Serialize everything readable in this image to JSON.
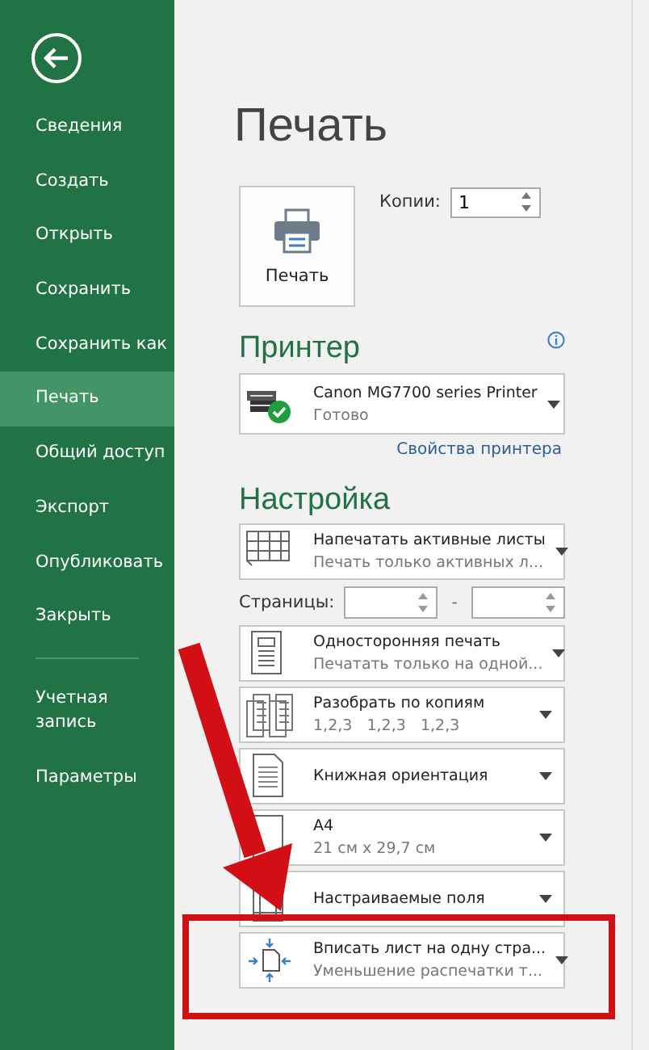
{
  "sidebar": {
    "items": [
      {
        "label": "Сведения",
        "selected": false
      },
      {
        "label": "Создать",
        "selected": false
      },
      {
        "label": "Открыть",
        "selected": false
      },
      {
        "label": "Сохранить",
        "selected": false
      },
      {
        "label": "Сохранить как",
        "selected": false
      },
      {
        "label": "Печать",
        "selected": true
      },
      {
        "label": "Общий доступ",
        "selected": false
      },
      {
        "label": "Экспорт",
        "selected": false
      },
      {
        "label": "Опубликовать",
        "selected": false
      },
      {
        "label": "Закрыть",
        "selected": false
      }
    ],
    "bottom_items": [
      {
        "label": "Учетная запись",
        "selected": false
      },
      {
        "label": "Параметры",
        "selected": false
      }
    ]
  },
  "title": "Печать",
  "print_button": {
    "label": "Печать"
  },
  "copies": {
    "label": "Копии:",
    "value": "1"
  },
  "printer": {
    "heading": "Принтер",
    "name": "Canon MG7700 series Printer",
    "status": "Готово",
    "ready": true,
    "link": "Свойства принтера"
  },
  "settings": {
    "heading": "Настройка",
    "pages_label": "Страницы:",
    "pages_separator": "-",
    "rows": [
      {
        "kind": "double",
        "title": "Напечатать активные листы",
        "subtitle": "Печать только активных л..."
      },
      {
        "kind": "pages"
      },
      {
        "kind": "double",
        "title": "Односторонняя печать",
        "subtitle": "Печатать только на одной..."
      },
      {
        "kind": "double",
        "title": "Разобрать по копиям",
        "subtitle": "1,2,3   1,2,3   1,2,3"
      },
      {
        "kind": "single",
        "title": "Книжная ориентация"
      },
      {
        "kind": "double",
        "title": "А4",
        "subtitle": "21 см x 29,7 см"
      },
      {
        "kind": "single",
        "title": "Настраиваемые поля"
      },
      {
        "kind": "double",
        "title": "Вписать лист на одну стра...",
        "subtitle": "Уменьшение распечатки т..."
      }
    ]
  }
}
